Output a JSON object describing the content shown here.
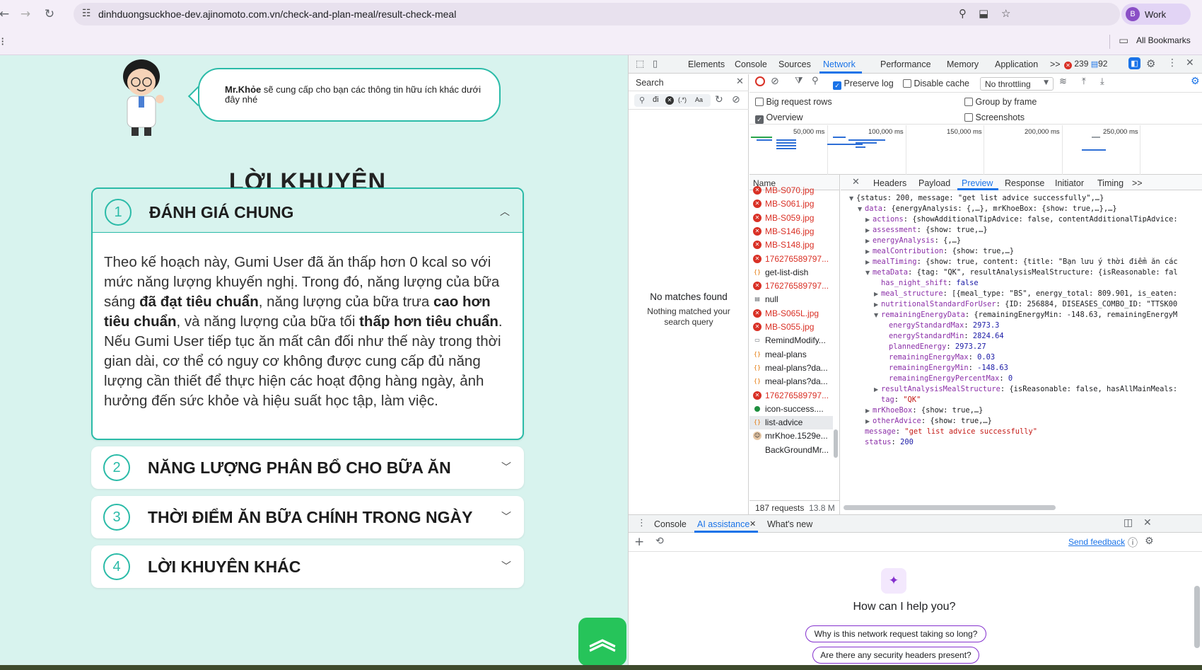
{
  "browser": {
    "url": "dinhduongsuckhoe-dev.ajinomoto.com.vn/check-and-plan-meal/result-check-meal",
    "profile_initial": "B",
    "profile_label": "Work",
    "bookmarks_label": "All Bookmarks"
  },
  "page": {
    "bubble_bold": "Mr.Khỏe",
    "bubble_text": " sẽ cung cấp cho bạn các thông tin hữu ích khác dưới đây nhé",
    "title": "LỜI KHUYÊN",
    "sections": [
      {
        "num": "1",
        "title": "ĐÁNH GIÁ CHUNG",
        "expanded": true
      },
      {
        "num": "2",
        "title": "NĂNG LƯỢNG PHÂN BỔ CHO BỮA ĂN",
        "expanded": false
      },
      {
        "num": "3",
        "title": "THỜI ĐIỂM ĂN BỮA CHÍNH TRONG NGÀY",
        "expanded": false
      },
      {
        "num": "4",
        "title": "LỜI KHUYÊN KHÁC",
        "expanded": false
      }
    ],
    "body": {
      "t1": "Theo kế hoạch này, Gumi User đã ăn thấp hơn 0 kcal so với mức năng lượng khuyến nghị. Trong đó, năng lượng của bữa sáng ",
      "b1": "đã đạt tiêu chuẩn",
      "t2": ", năng lượng của bữa trưa ",
      "b2": "cao hơn tiêu chuẩn",
      "t3": ", và năng lượng của bữa tối ",
      "b3": "thấp hơn tiêu chuẩn",
      "t4": ". Nếu Gumi User tiếp tục ăn mất cân đối như thế này trong thời gian dài, cơ thể có nguy cơ không được cung cấp đủ năng lượng cần thiết để thực hiện các hoạt động hàng ngày, ảnh hưởng đến sức khỏe và hiệu suất học tập, làm việc."
    }
  },
  "devtools": {
    "tabs": [
      "Elements",
      "Console",
      "Sources",
      "Network",
      "Performance",
      "Memory",
      "Application"
    ],
    "active_tab": "Network",
    "more": ">>",
    "error_count": "239",
    "message_count": "92",
    "search": {
      "title": "Search",
      "query": "đi",
      "regex": "(.*)",
      "case": "Aa",
      "no_match_title": "No matches found",
      "no_match_sub": "Nothing matched your search query"
    },
    "toolbar": {
      "preserve_log": "Preserve log",
      "disable_cache": "Disable cache",
      "throttling": "No throttling"
    },
    "settings": {
      "big_rows": "Big request rows",
      "group_by_frame": "Group by frame",
      "overview": "Overview",
      "screenshots": "Screenshots"
    },
    "overview_ticks": [
      "50,000 ms",
      "100,000 ms",
      "150,000 ms",
      "200,000 ms",
      "250,000 ms"
    ],
    "name_header": "Name",
    "requests": [
      {
        "name": "MB-S070.jpg",
        "kind": "err"
      },
      {
        "name": "MB-S061.jpg",
        "kind": "err"
      },
      {
        "name": "MB-S059.jpg",
        "kind": "err"
      },
      {
        "name": "MB-S146.jpg",
        "kind": "err"
      },
      {
        "name": "MB-S148.jpg",
        "kind": "err"
      },
      {
        "name": "176276589797...",
        "kind": "err"
      },
      {
        "name": "get-list-dish",
        "kind": "xhr"
      },
      {
        "name": "176276589797...",
        "kind": "err"
      },
      {
        "name": "null",
        "kind": "doc"
      },
      {
        "name": "MB-S065L.jpg",
        "kind": "err"
      },
      {
        "name": "MB-S055.jpg",
        "kind": "err"
      },
      {
        "name": "RemindModify...",
        "kind": "img"
      },
      {
        "name": "meal-plans",
        "kind": "xhr"
      },
      {
        "name": "meal-plans?da...",
        "kind": "xhr"
      },
      {
        "name": "meal-plans?da...",
        "kind": "xhr"
      },
      {
        "name": "176276589797...",
        "kind": "err"
      },
      {
        "name": "icon-success....",
        "kind": "ok"
      },
      {
        "name": "list-advice",
        "kind": "xhr"
      },
      {
        "name": "mrKhoe.1529e...",
        "kind": "avatar"
      },
      {
        "name": "BackGroundMr...",
        "kind": "none"
      }
    ],
    "selected_request": "list-advice",
    "footer_requests": "187 requests",
    "footer_size": "13.8 M",
    "detail_tabs": [
      "Headers",
      "Payload",
      "Preview",
      "Response",
      "Initiator",
      "Timing"
    ],
    "active_detail_tab": "Preview",
    "json": {
      "root": "{status: 200, message: \"get list advice successfully\",…}",
      "data": "{energyAnalysis: {,…}, mrKhoeBox: {show: true,…},…}",
      "actions": "{showAdditionalTipAdvice: false, contentAdditionalTipAdvice:",
      "assessment": "{show: true,…}",
      "energyAnalysis": "{,…}",
      "mealContribution": "{show: true,…}",
      "mealTiming": "{show: true, content: {title: \"Bạn lưu ý thời điểm ăn các",
      "metaData": "{tag: \"QK\", resultAnalysisMealStructure: {isReasonable: fal",
      "has_night_shift": "false",
      "meal_structure": "[{meal_type: \"BS\", energy_total: 809.901, is_eaten:",
      "nutritionalStandardForUser": "{ID: 256884, DISEASES_COMBO_ID: \"TTSK00",
      "remainingEnergyData": "{remainingEnergyMin: -148.63, remainingEnergyM",
      "energyStandardMax": "2973.3",
      "energyStandardMin": "2824.64",
      "plannedEnergy": "2973.27",
      "remainingEnergyMax": "0.03",
      "remainingEnergyMin": "-148.63",
      "remainingEnergyPercentMax": "0",
      "resultAnalysisMealStructure": "{isReasonable: false, hasAllMainMeals:",
      "tag": "\"QK\"",
      "mrKhoeBox": "{show: true,…}",
      "otherAdvice": "{show: true,…}",
      "message": "\"get list advice successfully\"",
      "status": "200"
    },
    "drawer": {
      "tabs": [
        "Console",
        "AI assistance",
        "What's new"
      ],
      "active": "AI assistance",
      "send_feedback": "Send feedback",
      "question": "How can I help you?",
      "chips": [
        "Why is this network request taking so long?",
        "Are there any security headers present?"
      ]
    }
  }
}
